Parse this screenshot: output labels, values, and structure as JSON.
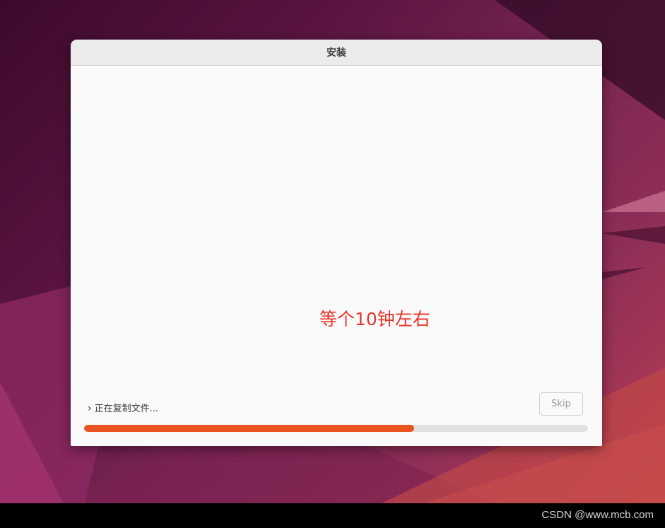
{
  "window": {
    "title": "安装"
  },
  "annotation": {
    "text": "等个10钟左右"
  },
  "status": {
    "chevron": "›",
    "text": "正在复制文件..."
  },
  "buttons": {
    "skip_label": "Skip"
  },
  "progress": {
    "fraction": 0.655,
    "color": "#e95420"
  },
  "watermark": {
    "text": "CSDN @www.mcb.com"
  }
}
